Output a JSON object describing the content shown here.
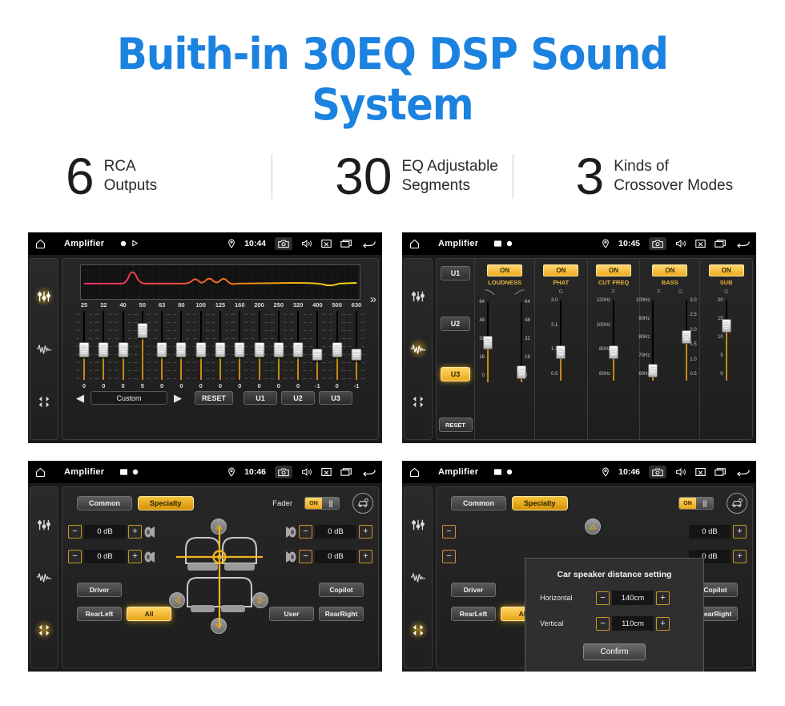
{
  "header": {
    "title": "Buith-in 30EQ DSP Sound System",
    "title_color": "#1b82e0",
    "stats": [
      {
        "number": "6",
        "line1": "RCA",
        "line2": "Outputs"
      },
      {
        "number": "30",
        "line1": "EQ Adjustable",
        "line2": "Segments"
      },
      {
        "number": "3",
        "line1": "Kinds of",
        "line2": "Crossover Modes"
      }
    ]
  },
  "statusbar": {
    "title": "Amplifier",
    "icons_left": [
      "home-icon"
    ],
    "icons_mini_u1": [
      "record-dot-icon",
      "play-triangle-icon"
    ],
    "icons_mini_u2": [
      "image-icon",
      "record-dot-icon"
    ],
    "icons_right": [
      "location-pin-icon",
      "camera-icon",
      "volume-icon",
      "close-box-icon",
      "recents-icon",
      "back-arrow-icon"
    ],
    "times": {
      "u1": "10:44",
      "u2": "10:45",
      "u3": "10:46",
      "u4": "10:46"
    }
  },
  "rail": {
    "icons": [
      "eq-sliders-icon",
      "waveform-icon",
      "balance-icon"
    ],
    "active": {
      "u1": 0,
      "u2": 1,
      "u3": 2,
      "u4": 2
    }
  },
  "eq_panel": {
    "frequencies": [
      "25",
      "32",
      "40",
      "50",
      "63",
      "80",
      "100",
      "125",
      "160",
      "200",
      "250",
      "320",
      "400",
      "500",
      "630"
    ],
    "values": [
      "0",
      "0",
      "0",
      "5",
      "0",
      "0",
      "0",
      "0",
      "0",
      "0",
      "0",
      "0",
      "-1",
      "0",
      "-1"
    ],
    "preset_prev": "◀",
    "preset_name": "Custom",
    "preset_next": "▶",
    "reset_label": "RESET",
    "user_presets": [
      "U1",
      "U2",
      "U3"
    ],
    "more_icon": "chevron-double-right-icon",
    "curve_colors": [
      "#ef2d6e",
      "#f07d1a",
      "#f2dc15"
    ]
  },
  "dsp_panel": {
    "user_buttons": [
      "U1",
      "U2",
      "U3"
    ],
    "active_user": "U3",
    "reset_label": "RESET",
    "columns": [
      {
        "name": "LOUDNESS",
        "state": "ON",
        "sub_labels": [
          "low-shelf-curve-icon",
          "high-shelf-curve-icon"
        ],
        "sliders": [
          {
            "scale": [
              "64",
              "48",
              "32",
              "16",
              "0"
            ],
            "value": "32",
            "pos": 0.5
          },
          {
            "scale": [
              "64",
              "48",
              "32",
              "16",
              "0"
            ],
            "value": "0",
            "pos": 0.05
          }
        ]
      },
      {
        "name": "PHAT",
        "state": "ON",
        "sub_labels": [
          "G"
        ],
        "sliders": [
          {
            "scale": [
              "3.0",
              "2.1",
              "1.3",
              "0.5"
            ],
            "value": "1.3",
            "pos": 0.32
          }
        ]
      },
      {
        "name": "CUT FREQ",
        "state": "ON",
        "sub_labels": [
          "F"
        ],
        "sliders": [
          {
            "scale": [
              "120Hz",
              "100Hz",
              "80Hz",
              "60Hz"
            ],
            "value": "80Hz",
            "pos": 0.33
          }
        ]
      },
      {
        "name": "BASS",
        "state": "ON",
        "sub_labels": [
          "F",
          "G"
        ],
        "sliders": [
          {
            "scale": [
              "100Hz",
              "90Hz",
              "80Hz",
              "70Hz",
              "60Hz"
            ],
            "value": "60Hz",
            "pos": 0.05
          },
          {
            "scale": [
              "3.0",
              "2.5",
              "2.0",
              "1.5",
              "1.0",
              "0.5"
            ],
            "value": "2.0",
            "pos": 0.56
          }
        ]
      },
      {
        "name": "SUB",
        "state": "ON",
        "sub_labels": [
          "G"
        ],
        "sliders": [
          {
            "scale": [
              "20",
              "15",
              "10",
              "5",
              "0"
            ],
            "value": "15",
            "pos": 0.72
          }
        ]
      }
    ]
  },
  "fader_panel": {
    "tabs": [
      {
        "label": "Common",
        "active": false
      },
      {
        "label": "Specialty",
        "active": true
      }
    ],
    "fader_label": "Fader",
    "fader_toggle": "ON",
    "car_settings_icon": "car-settings-icon",
    "steppers": [
      {
        "id": "front-left",
        "minus": "−",
        "value": "0 dB",
        "plus": "+"
      },
      {
        "id": "rear-left",
        "minus": "−",
        "value": "0 dB",
        "plus": "+"
      },
      {
        "id": "front-right",
        "minus": "−",
        "value": "0 dB",
        "plus": "+"
      },
      {
        "id": "rear-right",
        "minus": "−",
        "value": "0 dB",
        "plus": "+"
      }
    ],
    "position_buttons": [
      {
        "label": "Driver",
        "active": false
      },
      {
        "label": "Copilot",
        "active": false
      },
      {
        "label": "RearLeft",
        "active": false
      },
      {
        "label": "All",
        "active": true
      },
      {
        "label": "User",
        "active": false
      },
      {
        "label": "RearRight",
        "active": false
      }
    ],
    "nudge_icons": [
      "arrow-up-icon",
      "arrow-left-icon",
      "arrow-right-icon",
      "arrow-down-icon"
    ]
  },
  "dialog": {
    "title": "Car speaker distance setting",
    "rows": [
      {
        "label": "Horizontal",
        "minus": "−",
        "value": "140cm",
        "plus": "+"
      },
      {
        "label": "Vertical",
        "minus": "−",
        "value": "110cm",
        "plus": "+"
      }
    ],
    "confirm_label": "Confirm"
  }
}
